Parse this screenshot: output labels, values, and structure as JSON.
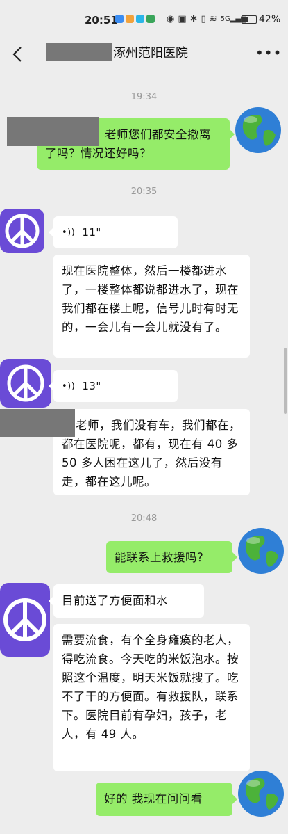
{
  "status": {
    "time": "20:51",
    "battery": "42%",
    "battery_level": 0.42,
    "signal": "5G"
  },
  "header": {
    "title": "涿州范阳医院"
  },
  "timestamps": [
    "19:34",
    "20:35",
    "20:48"
  ],
  "messages": {
    "m1": "老师您们都安全撤离了吗？情况还好吗？",
    "m2_voice": "11\"",
    "m3": "现在医院整体，然后一楼都进水了，一楼整体都说都进水了，现在我们都在楼上呢，信号儿时有时无的，一会儿有一会儿就没有了。",
    "m4_voice": "13\"",
    "m5": "老师，我们没有车，我们都在，都在医院呢，都有，现在有 40 多 50 多人困在这儿了，然后没有走，都在这儿呢。",
    "m6": "能联系上救援吗？",
    "m7": "目前送了方便面和水",
    "m8": "需要流食，有个全身瘫痪的老人，得吃流食。今天吃的米饭泡水。按照这个温度，明天米饭就搜了。吃不了干的方便面。有救援队，联系下。医院目前有孕妇，孩子，老人，有 49 人。",
    "m9": "好的 我现在问问看"
  },
  "icons": {
    "back": "back-arrow-icon",
    "more": "more-icon",
    "voice": "voice-wave-icon",
    "avatar_me": "earth-icon",
    "avatar_them": "peace-sign-icon"
  },
  "colors": {
    "me_bubble": "#95ec69",
    "them_bubble": "#ffffff",
    "bg": "#ededed",
    "peace_avatar": "#6a4bd6"
  }
}
